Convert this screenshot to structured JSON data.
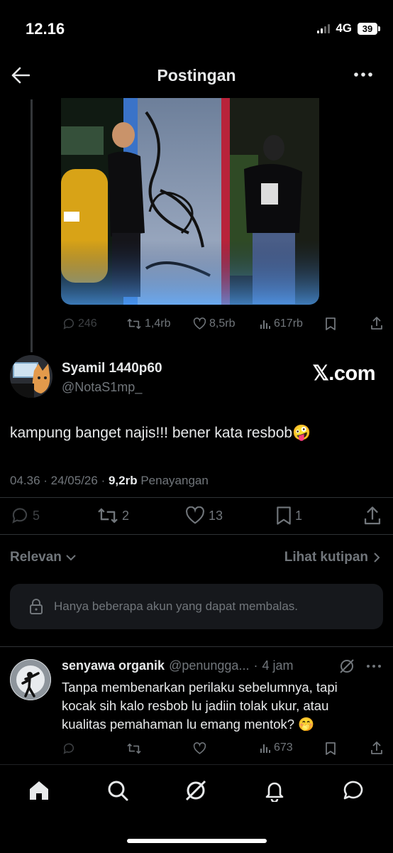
{
  "status_bar": {
    "time": "12.16",
    "network": "4G",
    "battery": "39"
  },
  "header": {
    "title": "Postingan"
  },
  "quoted_post_actions": {
    "replies": "246",
    "reposts": "1,4rb",
    "likes": "8,5rb",
    "views": "617rb"
  },
  "post": {
    "author_name": "Syamil 1440p60",
    "author_handle": "@NotaS1mp_",
    "watermark": "𝕏.com",
    "text": "kampung banget najis!!! bener kata resbob",
    "emoji": "🤪",
    "time": "04.36",
    "date": "24/05/26",
    "view_count": "9,2rb",
    "view_label": "Penayangan",
    "stats": {
      "replies": "5",
      "reposts": "2",
      "likes": "13",
      "bookmarks": "1"
    }
  },
  "sort": {
    "label": "Relevan",
    "quotes_label": "Lihat kutipan"
  },
  "restriction_notice": "Hanya beberapa akun yang dapat membalas.",
  "reply": {
    "author_name": "senyawa organik",
    "author_handle": "@penungga...",
    "time": "4 jam",
    "text": "Tanpa membenarkan perilaku sebelumnya, tapi kocak sih kalo resbob lu jadiin tolak ukur, atau kualitas pemahaman lu emang mentok?",
    "emoji": "🤭",
    "views": "673"
  },
  "colors": {
    "background": "#000000",
    "text": "#e7e9ea",
    "muted": "#71767b"
  }
}
